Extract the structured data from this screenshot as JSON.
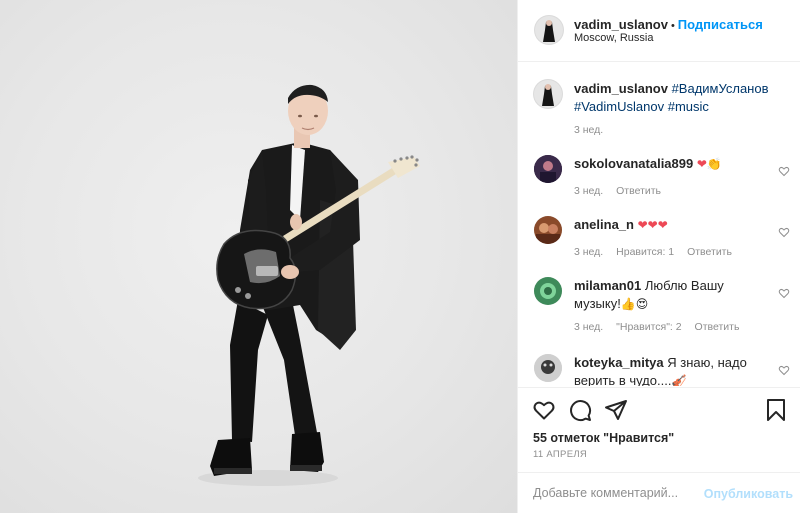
{
  "post": {
    "author": "vadim_uslanov",
    "follow_label": "Подписаться",
    "separator": "•",
    "location": "Moscow, Russia"
  },
  "caption": {
    "username": "vadim_uslanov",
    "tags": [
      "#ВадимУсланов",
      "#VadimUslanov",
      "#music"
    ],
    "time": "3 нед."
  },
  "comments": [
    {
      "username": "sokolovanatalia899",
      "text": "",
      "emoji": "❤👏",
      "time": "3 нед.",
      "likes": "",
      "reply": "Ответить"
    },
    {
      "username": "anelina_n",
      "text": "",
      "emoji": "❤❤❤",
      "time": "3 нед.",
      "likes": "Нравится: 1",
      "reply": "Ответить"
    },
    {
      "username": "milaman01",
      "text": "Люблю Вашу музыку!",
      "emoji": "👍😍",
      "time": "3 нед.",
      "likes": "\"Нравится\": 2",
      "reply": "Ответить"
    },
    {
      "username": "koteyka_mitya",
      "text": "Я знаю, надо верить в чудо....",
      "emoji": "🎻",
      "time": "",
      "likes": "",
      "reply": ""
    }
  ],
  "footer": {
    "likes_text": "55 отметок \"Нравится\"",
    "date": "11 АПРЕЛЯ",
    "comment_placeholder": "Добавьте комментарий...",
    "publish_label": "Опубликовать"
  },
  "icons": {
    "like": "heart-icon",
    "comment": "comment-icon",
    "share": "share-icon",
    "save": "bookmark-icon"
  },
  "colors": {
    "link_blue": "#0095f6",
    "muted_text": "#8e8e8e",
    "hashtag": "#00376b",
    "publish_disabled": "#b2dffc"
  }
}
